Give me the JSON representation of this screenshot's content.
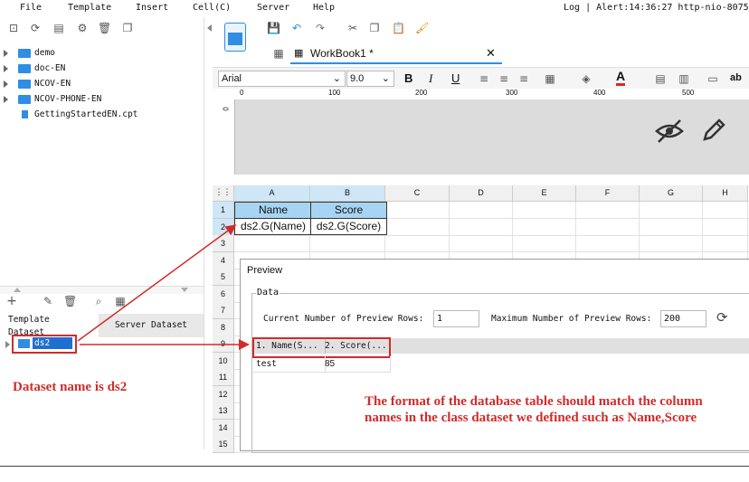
{
  "menu": [
    "File",
    "Template",
    "Insert",
    "Cell(C)",
    "Server",
    "Help"
  ],
  "status_text": "Log | Alert:14:36:27 http-nio-8075-",
  "tree": [
    {
      "label": "demo",
      "type": "folder"
    },
    {
      "label": "doc-EN",
      "type": "folder"
    },
    {
      "label": "NCOV-EN",
      "type": "folder"
    },
    {
      "label": "NCOV-PHONE-EN",
      "type": "folder"
    },
    {
      "label": "GettingStartedEN.cpt",
      "type": "file"
    }
  ],
  "dataset_tabs": {
    "template": "Template Dataset",
    "server": "Server Dataset"
  },
  "dataset_item": "ds2",
  "workbook_tab": "WorkBook1 *",
  "font": {
    "name": "Arial",
    "size": "9.0"
  },
  "ruler_ticks": [
    "0",
    "100",
    "200",
    "300",
    "400",
    "500"
  ],
  "ruler_v": "0",
  "columns": [
    "A",
    "B",
    "C",
    "D",
    "E",
    "F",
    "G",
    "H"
  ],
  "rows": [
    "1",
    "2",
    "3",
    "4",
    "5",
    "6",
    "7",
    "8",
    "9",
    "10",
    "11",
    "12",
    "13",
    "14",
    "15"
  ],
  "cells": {
    "a1": "Name",
    "b1": "Score",
    "a2": "ds2.G(Name)",
    "b2": "ds2.G(Score)"
  },
  "preview": {
    "title": "Preview",
    "group_label": "Data",
    "current_rows_label": "Current Number of Preview Rows:",
    "current_rows_value": "1",
    "max_rows_label": "Maximum Number of Preview Rows:",
    "max_rows_value": "200",
    "table_headers": [
      "1. Name(S...",
      "2. Score(..."
    ],
    "table_rows": [
      [
        "test",
        "85"
      ]
    ]
  },
  "annotations": {
    "dataset_note": "Dataset name is ds2",
    "format_note_line1": "The format of the database table should match the column",
    "format_note_line2": "names in the class dataset we defined such as Name,Score"
  },
  "colors": {
    "accent_red": "#d22b2b",
    "header_blue": "#a7d4f2",
    "folder_blue": "#2f8de4",
    "selection_blue": "#1f6fd1"
  }
}
